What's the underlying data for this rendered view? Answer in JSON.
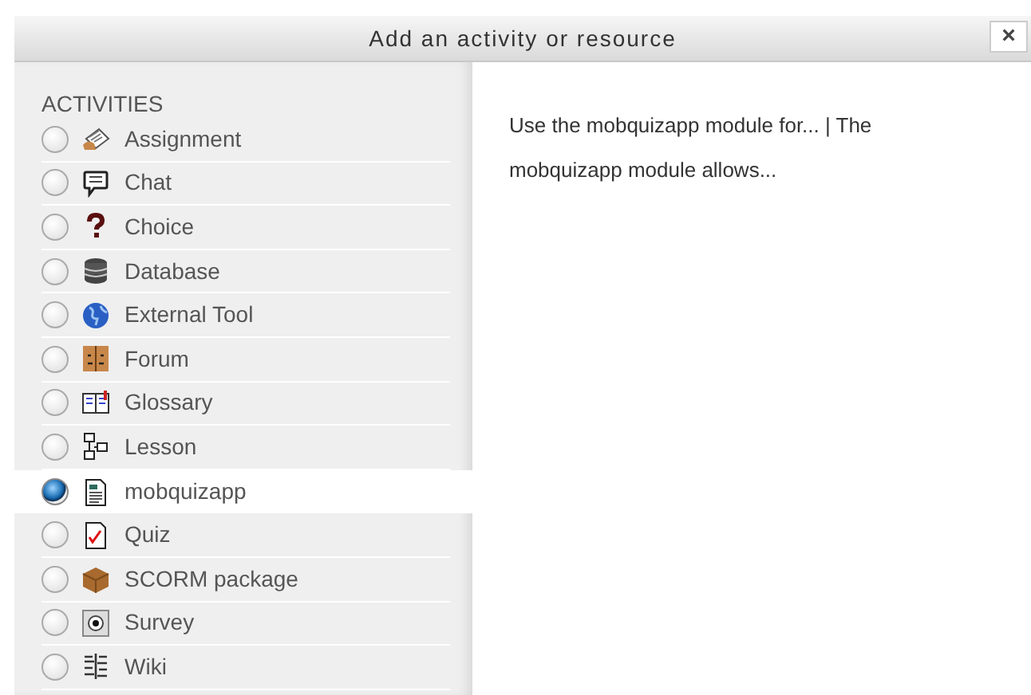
{
  "dialog": {
    "title": "Add an activity or resource",
    "close": "×"
  },
  "section_title": "ACTIVITIES",
  "items": [
    {
      "label": "Assignment",
      "kind": "assignment",
      "selected": false
    },
    {
      "label": "Chat",
      "kind": "chat",
      "selected": false
    },
    {
      "label": "Choice",
      "kind": "choice",
      "selected": false
    },
    {
      "label": "Database",
      "kind": "database",
      "selected": false
    },
    {
      "label": "External Tool",
      "kind": "globe",
      "selected": false
    },
    {
      "label": "Forum",
      "kind": "forum",
      "selected": false
    },
    {
      "label": "Glossary",
      "kind": "glossary",
      "selected": false
    },
    {
      "label": "Lesson",
      "kind": "lesson",
      "selected": false
    },
    {
      "label": "mobquizapp",
      "kind": "page",
      "selected": true
    },
    {
      "label": "Quiz",
      "kind": "quiz",
      "selected": false
    },
    {
      "label": "SCORM package",
      "kind": "box",
      "selected": false
    },
    {
      "label": "Survey",
      "kind": "survey",
      "selected": false
    },
    {
      "label": "Wiki",
      "kind": "wiki",
      "selected": false
    }
  ],
  "description": "Use the mobquizapp module for... | The mobquizapp module allows..."
}
